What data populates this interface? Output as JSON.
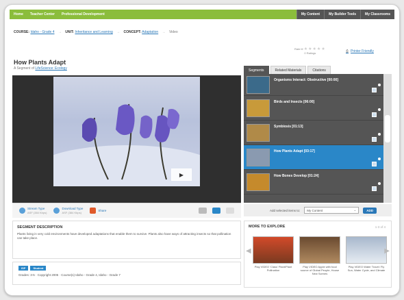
{
  "topnav": {
    "items": [
      "Home",
      "Teacher Center",
      "Professional Development"
    ],
    "right_items": [
      "My Content",
      "My Builder Tools",
      "My Classrooms"
    ]
  },
  "breadcrumb": {
    "course_label": "COURSE:",
    "course": "Idaho - Grade 4",
    "unit_label": "UNIT:",
    "unit": "Inheritance and Learning",
    "concept_label": "CONCEPT:",
    "concept": "Adaptation",
    "current": "Video"
  },
  "rating": {
    "label": "Rate it!",
    "stars": "★★★★★",
    "count": "0 Ratings"
  },
  "printer_label": "Printer Friendly",
  "page_title": "How Plants Adapt",
  "subtitle": {
    "prefix": "A Segment of",
    "link": "LifeScience: Ecology"
  },
  "tabs": [
    "Segments",
    "Related Materials",
    "Citations"
  ],
  "segments": [
    {
      "name": "Organisms Interact: Obstructive [00:00]"
    },
    {
      "name": "Birds and Insects [06:00]"
    },
    {
      "name": "Symbiosis [01:13]"
    },
    {
      "name": "How Plants Adapt [03:17]"
    },
    {
      "name": "How Bones Develop [01:24]"
    }
  ],
  "controls": {
    "stream": {
      "label": "Stream Type",
      "sub": "ASF (384 Kbps)"
    },
    "download": {
      "label": "Download Type",
      "sub": "ASF (384 Kbps)"
    },
    "share": "Share"
  },
  "add_bar": {
    "label": "Add selected items to:",
    "select": "My Content",
    "button": "ADD"
  },
  "description": {
    "heading": "SEGMENT DESCRIPTION",
    "text": "Plants living in very cold environments have developed adaptations that enable them to survive. Plants also have ways of attracting insects so that pollination can take place."
  },
  "meta": {
    "badges": [
      "ISP",
      "Student"
    ],
    "info": "Grades: 3-5   ·   Copyright 2005   ·   Course(s) Idaho - Grade 4, Idaho - Grade 7"
  },
  "more": {
    "heading": "MORE TO EXPLORE",
    "page": "1-3 of 4",
    "cards": [
      {
        "caption": "Play VIDEO 'Class' Plant/Plant Pollination"
      },
      {
        "caption": "Play VIDEO Apple with food source of Global People, House New Scenes"
      },
      {
        "caption": "Play VIDEO Water Travel: Fly Sun, Water Cycle, and Climate"
      }
    ]
  },
  "colors": {
    "brand_green": "#8bbd3c",
    "accent_blue": "#2a87c8",
    "panel_dark": "#555555"
  }
}
